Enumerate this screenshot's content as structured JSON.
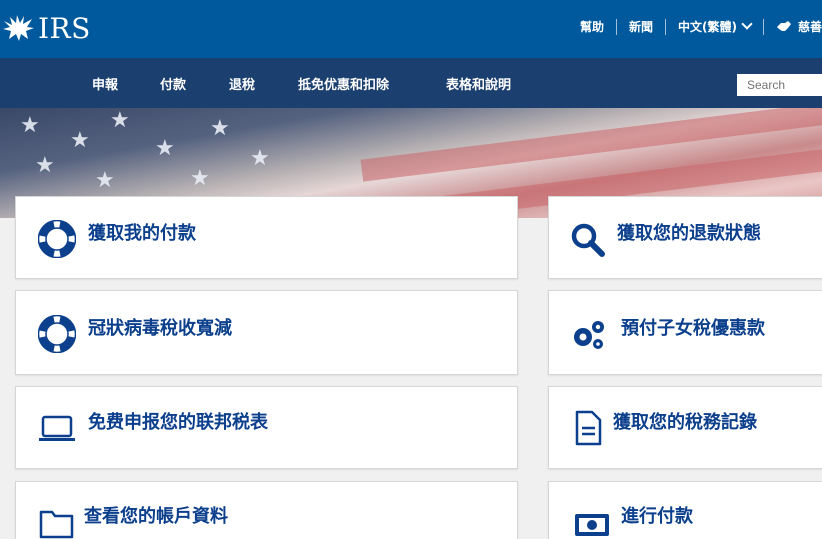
{
  "header": {
    "logo_text": "IRS",
    "utility": {
      "help": "幫助",
      "news": "新聞",
      "language": "中文(繁體)",
      "charity": "慈善"
    }
  },
  "nav": {
    "items": [
      "申報",
      "付款",
      "退稅",
      "抵免优惠和扣除",
      "表格和說明"
    ],
    "search_placeholder": "Search"
  },
  "cards": {
    "c0": "獲取我的付款",
    "c1": "獲取您的退款狀態",
    "c2": "冠狀病毒稅收寬減",
    "c3": "預付子女稅優惠款",
    "c4": "免费申报您的联邦税表",
    "c5": "獲取您的稅務記錄",
    "c6": "查看您的帳戶資料",
    "c7": "進行付款"
  },
  "icons": {
    "c0": "lifebuoy-icon",
    "c1": "search-icon",
    "c2": "lifebuoy-icon",
    "c3": "gears-icon",
    "c4": "laptop-icon",
    "c5": "document-icon",
    "c6": "folder-icon",
    "c7": "money-icon"
  },
  "colors": {
    "header_bg": "#00599c",
    "nav_bg": "#1b3f6e",
    "link_blue": "#0c3f8c"
  }
}
